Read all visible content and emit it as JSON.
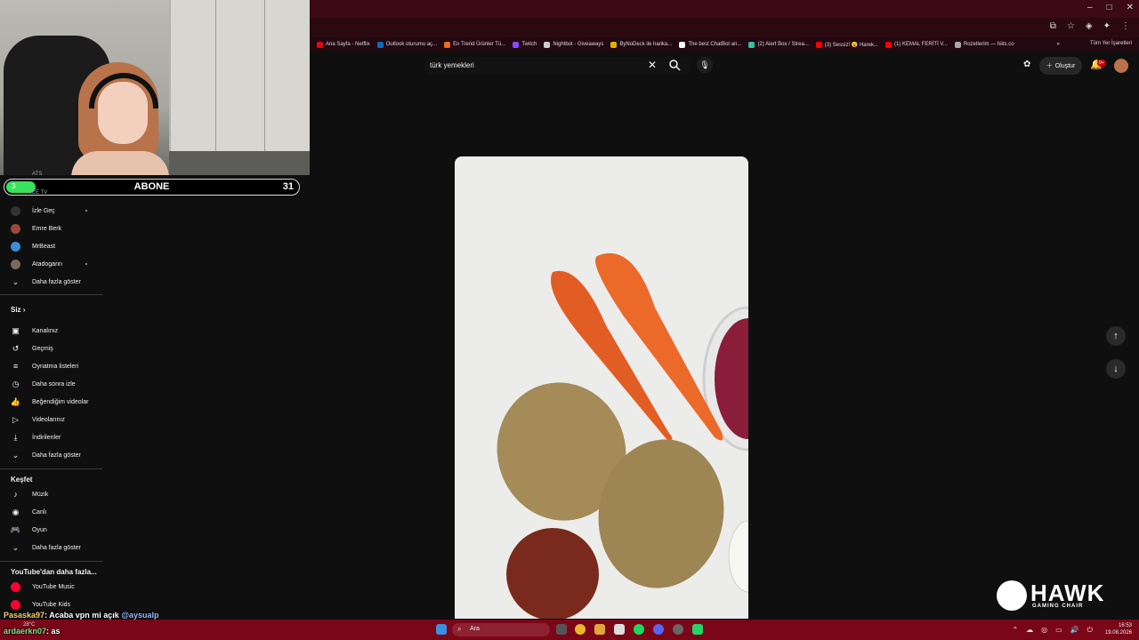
{
  "browser": {
    "window_controls": [
      "–",
      "□",
      "✕"
    ],
    "bookmarks": [
      {
        "label": "Ana Sayfa - Netflix",
        "color": "#e50914"
      },
      {
        "label": "Outlook oturumu aç...",
        "color": "#0f6cbd"
      },
      {
        "label": "En Trend Ürünler Tü...",
        "color": "#f26b1d"
      },
      {
        "label": "Twitch",
        "color": "#9146ff"
      },
      {
        "label": "Nightbot - Giveaways",
        "color": "#cccccc"
      },
      {
        "label": "ByNoDeck ile harika...",
        "color": "#e0b000"
      },
      {
        "label": "The best ChatBot an...",
        "color": "#ffffff"
      },
      {
        "label": "(2) Alert Box / Strea...",
        "color": "#31c3a2"
      },
      {
        "label": "(3) Sessiz! 😮 Harek...",
        "color": "#ff0000"
      },
      {
        "label": "(1) KEMAL FERİTİ V...",
        "color": "#ff0000"
      },
      {
        "label": "Rozetlerim — hiits.co",
        "color": "#aaaaaa"
      }
    ],
    "bookmarks_more": "»",
    "all_bookmarks": "Tüm Yer İşaretleri"
  },
  "stream_overlay": {
    "sub_goal": {
      "left": "3",
      "label": "ABONE",
      "right": "31",
      "progress": 0.1
    },
    "partial_label": "ICE TV",
    "partial_top": "ATS"
  },
  "sidebar": {
    "subscriptions": [
      {
        "label": "İzle Geç",
        "color": "#333333",
        "live": true
      },
      {
        "label": "Emre Berk",
        "color": "#9b4a3a",
        "live": false
      },
      {
        "label": "MrBeast",
        "color": "#3a8fd6",
        "live": false
      },
      {
        "label": "Atadogann",
        "color": "#7a6a5a",
        "live": true
      }
    ],
    "show_more_subs": "Daha fazla göster",
    "you_heading": "Siz",
    "you_items": [
      {
        "icon": "channel-icon",
        "glyph": "▣",
        "label": "Kanalınız"
      },
      {
        "icon": "history-icon",
        "glyph": "↺",
        "label": "Geçmiş"
      },
      {
        "icon": "playlists-icon",
        "glyph": "≡",
        "label": "Oynatma listeleri"
      },
      {
        "icon": "watch-later-icon",
        "glyph": "◷",
        "label": "Daha sonra izle"
      },
      {
        "icon": "liked-icon",
        "glyph": "👍",
        "label": "Beğendiğim videolar"
      },
      {
        "icon": "your-videos-icon",
        "glyph": "▷",
        "label": "Videolarınız"
      },
      {
        "icon": "downloads-icon",
        "glyph": "⤓",
        "label": "İndirilenler"
      },
      {
        "icon": "chevron-down-icon",
        "glyph": "⌄",
        "label": "Daha fazla göster"
      }
    ],
    "explore_heading": "Keşfet",
    "explore_items": [
      {
        "icon": "music-icon",
        "glyph": "♪",
        "label": "Müzik"
      },
      {
        "icon": "live-icon",
        "glyph": "◉",
        "label": "Canlı"
      },
      {
        "icon": "gaming-icon",
        "glyph": "🎮",
        "label": "Oyun"
      },
      {
        "icon": "chevron-down-icon",
        "glyph": "⌄",
        "label": "Daha fazla göster"
      }
    ],
    "more_heading": "YouTube'dan daha fazla...",
    "more_items": [
      {
        "icon": "youtube-music-icon",
        "color": "#ff0033",
        "label": "YouTube Music"
      },
      {
        "icon": "youtube-kids-icon",
        "color": "#ff0033",
        "label": "YouTube Kids"
      }
    ]
  },
  "youtube": {
    "search_value": "türk yemekleri",
    "create_label": "Oluştur",
    "notifications_badge": "9+"
  },
  "shorts_nav": {
    "up": "↑",
    "down": "↓"
  },
  "watermark": {
    "brand": "HAWK",
    "tagline": "GAMING CHAIR"
  },
  "chat": [
    {
      "user": "Pasaska97",
      "message": ": Acaba vpn mi açık ",
      "mention": "@aysualp"
    },
    {
      "user": "ardaerkn07",
      "message": ": as",
      "mention": ""
    }
  ],
  "taskbar": {
    "search_placeholder": "Ara",
    "weather": "28°C",
    "time": "16:53",
    "date": "19.08.2026",
    "tray": [
      "⌃",
      "☁",
      "◎",
      "▭",
      "🔊",
      "⏻"
    ]
  }
}
